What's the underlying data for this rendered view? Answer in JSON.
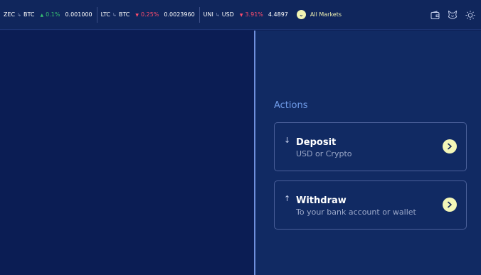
{
  "ticker": [
    {
      "base": "ZEC",
      "quote": "BTC",
      "change": "0.1%",
      "direction": "up",
      "price": "0.001000"
    },
    {
      "base": "LTC",
      "quote": "BTC",
      "change": "0.25%",
      "direction": "down",
      "price": "0.0023960"
    },
    {
      "base": "UNI",
      "quote": "USD",
      "change": "3.91%",
      "direction": "down",
      "price": "4.4897"
    }
  ],
  "all_markets_label": "All Markets",
  "top_icons": [
    "wallet-icon",
    "fox-icon",
    "sun-icon"
  ],
  "actions": {
    "title": "Actions",
    "deposit": {
      "title": "Deposit",
      "subtitle": "USD or Crypto"
    },
    "withdraw": {
      "title": "Withdraw",
      "subtitle": "To your bank account or wallet"
    }
  },
  "colors": {
    "accent": "#f2f4b3",
    "up": "#38c172",
    "down": "#ff4d6d",
    "divider": "#6f8fdc"
  }
}
